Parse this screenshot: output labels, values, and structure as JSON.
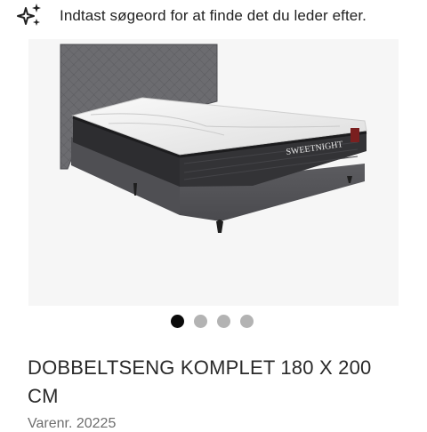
{
  "search": {
    "placeholder": "Indtast søgeord for at finde det du leder efter."
  },
  "product": {
    "image_brand": "SWEETNIGHT",
    "gallery": {
      "count": 4,
      "active_index": 0
    },
    "title": "DOBBELTSENG KOMPLET 180 X 200 CM",
    "sku_text": "Varenr. 20225"
  },
  "colors": {
    "active_dot": "#0a0a0a",
    "inactive_dot": "#b3b3b3",
    "title": "#2a2a2a",
    "sku": "#6e6e6e"
  }
}
